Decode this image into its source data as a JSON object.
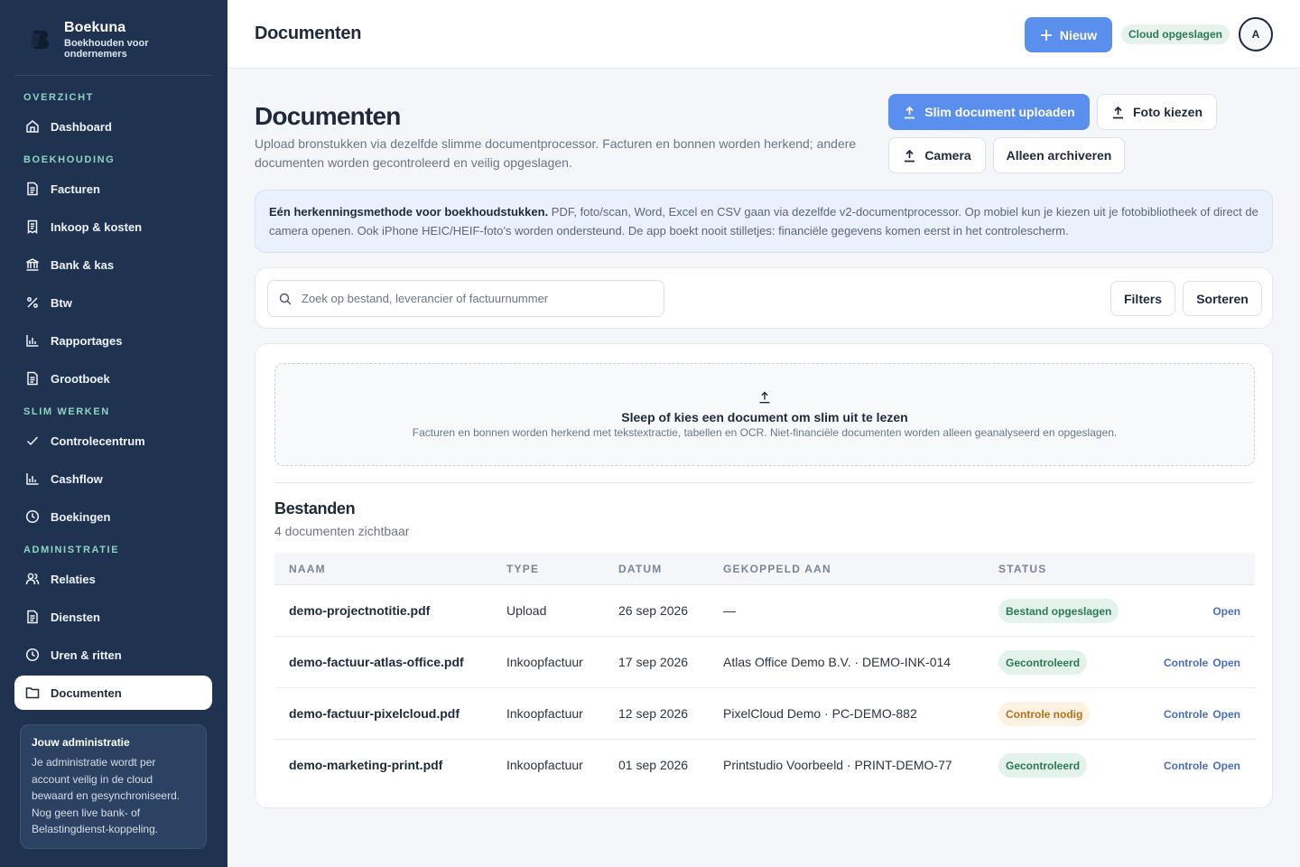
{
  "brand": {
    "name": "Boekuna",
    "tagline": "Boekhouden voor ondernemers"
  },
  "sidebar": {
    "sections": [
      {
        "label": "OVERZICHT"
      },
      {
        "label": "BOEKHOUDING"
      },
      {
        "label": "SLIM WERKEN"
      },
      {
        "label": "ADMINISTRATIE"
      }
    ],
    "items": [
      {
        "label": "Dashboard",
        "icon": "home-icon"
      },
      {
        "label": "Facturen",
        "icon": "document-icon"
      },
      {
        "label": "Inkoop & kosten",
        "icon": "receipt-icon"
      },
      {
        "label": "Bank & kas",
        "icon": "bank-icon"
      },
      {
        "label": "Btw",
        "icon": "percent-icon"
      },
      {
        "label": "Rapportages",
        "icon": "bar-chart-icon"
      },
      {
        "label": "Grootboek",
        "icon": "document-icon"
      },
      {
        "label": "Controlecentrum",
        "icon": "check-icon"
      },
      {
        "label": "Cashflow",
        "icon": "bar-chart-icon"
      },
      {
        "label": "Boekingen",
        "icon": "clock-icon"
      },
      {
        "label": "Relaties",
        "icon": "users-icon"
      },
      {
        "label": "Diensten",
        "icon": "document-icon"
      },
      {
        "label": "Uren & ritten",
        "icon": "clock-icon"
      },
      {
        "label": "Documenten",
        "icon": "folder-icon"
      }
    ],
    "admin_card": {
      "title": "Jouw administratie",
      "text": "Je administratie wordt per account veilig in de cloud bewaard en gesynchroniseerd. Nog geen live bank- of Belastingdienst-koppeling."
    }
  },
  "topbar": {
    "title": "Documenten",
    "new_label": "Nieuw",
    "cloud_label": "Cloud opgeslagen",
    "avatar_initial": "A"
  },
  "page": {
    "title": "Documenten",
    "description": "Upload bronstukken via dezelfde slimme documentprocessor. Facturen en bonnen worden herkend; andere documenten worden gecontroleerd en veilig opgeslagen.",
    "buttons": {
      "smart_upload": "Slim document uploaden",
      "photo": "Foto kiezen",
      "camera": "Camera",
      "archive": "Alleen archiveren"
    }
  },
  "info_banner": {
    "bold": "Eén herkenningsmethode voor boekhoudstukken.",
    "text": " PDF, foto/scan, Word, Excel en CSV gaan via dezelfde v2-documentprocessor. Op mobiel kun je kiezen uit je fotobibliotheek of direct de camera openen. Ook iPhone HEIC/HEIF-foto’s worden ondersteund. De app boekt nooit stilletjes: financiële gegevens komen eerst in het controlescherm."
  },
  "search": {
    "placeholder": "Zoek op bestand, leverancier of factuurnummer",
    "filters_label": "Filters",
    "sort_label": "Sorteren"
  },
  "dropzone": {
    "title": "Sleep of kies een document om slim uit te lezen",
    "description": "Facturen en bonnen worden herkend met tekstextractie, tabellen en OCR. Niet-financiële documenten worden alleen geanalyseerd en opgeslagen."
  },
  "files": {
    "title": "Bestanden",
    "count": "4 documenten zichtbaar",
    "headers": {
      "name": "NAAM",
      "type": "TYPE",
      "date": "DATUM",
      "linked": "GEKOPPELD AAN",
      "status": "STATUS"
    },
    "rows": [
      {
        "name": "demo-projectnotitie.pdf",
        "type": "Upload",
        "date": "26 sep 2026",
        "linked": "—",
        "status": "Bestand opgeslagen",
        "status_kind": "ok",
        "review": "",
        "open": "Open"
      },
      {
        "name": "demo-factuur-atlas-office.pdf",
        "type": "Inkoopfactuur",
        "date": "17 sep 2026",
        "linked": "Atlas Office Demo B.V. · DEMO-INK-014",
        "status": "Gecontroleerd",
        "status_kind": "ok",
        "review": "Controle",
        "open": "Open"
      },
      {
        "name": "demo-factuur-pixelcloud.pdf",
        "type": "Inkoopfactuur",
        "date": "12 sep 2026",
        "linked": "PixelCloud Demo · PC-DEMO-882",
        "status": "Controle nodig",
        "status_kind": "warn",
        "review": "Controle",
        "open": "Open"
      },
      {
        "name": "demo-marketing-print.pdf",
        "type": "Inkoopfactuur",
        "date": "01 sep 2026",
        "linked": "Printstudio Voorbeeld · PRINT-DEMO-77",
        "status": "Gecontroleerd",
        "status_kind": "ok",
        "review": "Controle",
        "open": "Open"
      }
    ]
  },
  "colors": {
    "sidebar_bg": "#1f3350",
    "accent": "#5b8fee",
    "section_label": "#8fd3c4",
    "status_ok": "#2b7a55",
    "status_warn": "#b2711a"
  }
}
